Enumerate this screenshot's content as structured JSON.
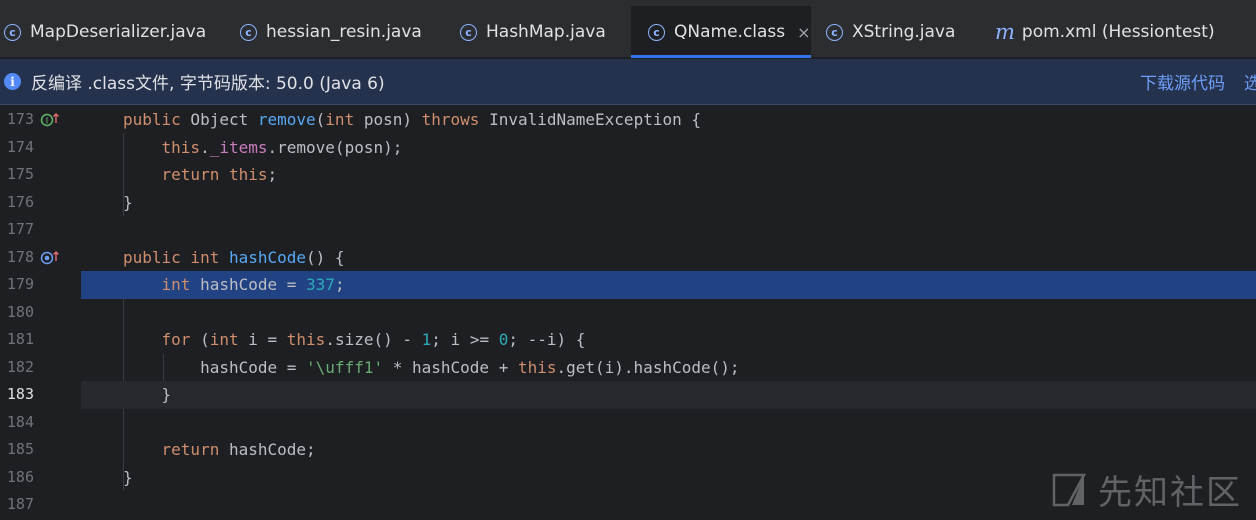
{
  "tabs": [
    {
      "label": "MapDeserializer.java",
      "icon": "class-icon",
      "active": false
    },
    {
      "label": "hessian_resin.java",
      "icon": "class-icon",
      "active": false
    },
    {
      "label": "HashMap.java",
      "icon": "class-icon",
      "active": false
    },
    {
      "label": "QName.class",
      "icon": "class-icon",
      "active": true,
      "close": "×"
    },
    {
      "label": "XString.java",
      "icon": "class-icon",
      "active": false
    },
    {
      "label": "pom.xml (Hessiontest)",
      "icon": "maven-icon",
      "icon_glyph": "m",
      "active": false
    }
  ],
  "banner": {
    "icon_glyph": "i",
    "text": "反编译 .class文件, 字节码版本: 50.0 (Java 6)",
    "link_download": "下载源代码",
    "link_select": "选"
  },
  "editor": {
    "selected_line": 179,
    "caret_line": 183,
    "lines": [
      {
        "num": "173",
        "text": "public Object remove(int posn) throws InvalidNameException {",
        "gutter_icon": "implementing-method-icon"
      },
      {
        "num": "174",
        "text": "this._items.remove(posn);"
      },
      {
        "num": "175",
        "text": "return this;"
      },
      {
        "num": "176",
        "text": "}"
      },
      {
        "num": "177",
        "text": ""
      },
      {
        "num": "178",
        "text": "public int hashCode() {",
        "gutter_icon": "override-method-icon"
      },
      {
        "num": "179",
        "text": "int hashCode = 337;"
      },
      {
        "num": "180",
        "text": ""
      },
      {
        "num": "181",
        "text": "for (int i = this.size() - 1; i >= 0; --i) {"
      },
      {
        "num": "182",
        "text": "hashCode = '\\ufff1' * hashCode + this.get(i).hashCode();"
      },
      {
        "num": "183",
        "text": "}"
      },
      {
        "num": "184",
        "text": ""
      },
      {
        "num": "185",
        "text": "return hashCode;"
      },
      {
        "num": "186",
        "text": "}"
      },
      {
        "num": "187",
        "text": ""
      }
    ]
  },
  "watermark": {
    "text": "先知社区"
  },
  "colors": {
    "background": "#1e1f22",
    "selection": "#214283",
    "keyword": "#cf8e6d",
    "function": "#56a8f5",
    "number": "#2aacb8",
    "field": "#c77dbb",
    "string": "#6aab73",
    "accent": "#3574f0"
  }
}
